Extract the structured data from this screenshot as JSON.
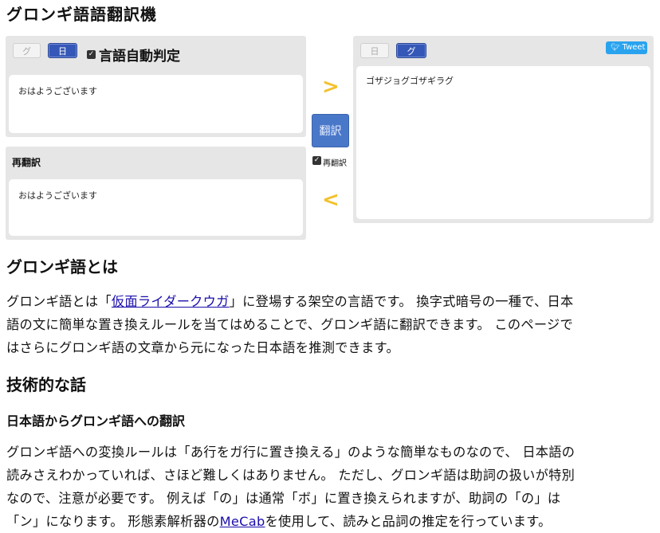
{
  "title": "グロンギ語語翻訳機",
  "left_panel": {
    "btn_gurongi": "グ",
    "btn_japanese": "日",
    "auto_detect_label": "言語自動判定",
    "input_text": "おはようございます"
  },
  "retranslate_panel": {
    "header": "再翻訳",
    "text": "おはようございます"
  },
  "center": {
    "arrow_right": ">",
    "arrow_left": "<",
    "translate_button": "翻訳",
    "retranslate_checkbox_label": "再翻訳"
  },
  "right_panel": {
    "btn_japanese": "日",
    "btn_gurongi": "グ",
    "tweet_label": "Tweet",
    "output_text": "ゴザジョグゴザギラグ"
  },
  "sections": {
    "about_heading": "グロンギ語とは",
    "about_pre": "グロンギ語とは「",
    "about_link": "仮面ライダークウガ",
    "about_post_line1": "」に登場する架空の言語です。 換字式暗号の一種で、日本",
    "about_line2": "語の文に簡単な置き換えルールを当てはめることで、グロンギ語に翻訳できます。 このページで",
    "about_line3": "はさらにグロンギ語の文章から元になった日本語を推測できます。",
    "tech_heading": "技術的な話",
    "ja_to_gu_heading": "日本語からグロンギ語への翻訳",
    "tech_line1": "グロンギ語への変換ルールは「あ行をガ行に置き換える」のような簡単なものなので、 日本語の",
    "tech_line2": "読みさえわかっていれば、さほど難しくはありません。 ただし、グロンギ語は助詞の扱いが特別",
    "tech_line3": "なので、注意が必要です。 例えば「の」は通常「ボ」に置き換えられますが、助詞の「の」は",
    "tech_line4_pre": "「ン」になります。 形態素解析器の",
    "tech_link": "MeCab",
    "tech_line4_post": "を使用して、読みと品詞の推定を行っています。"
  },
  "colors": {
    "panel_bg": "#e6e6e6",
    "active_lang": "#3557b7",
    "translate_button": "#4a78c9",
    "arrow": "#f2c22e",
    "tweet": "#2aa3ef"
  }
}
